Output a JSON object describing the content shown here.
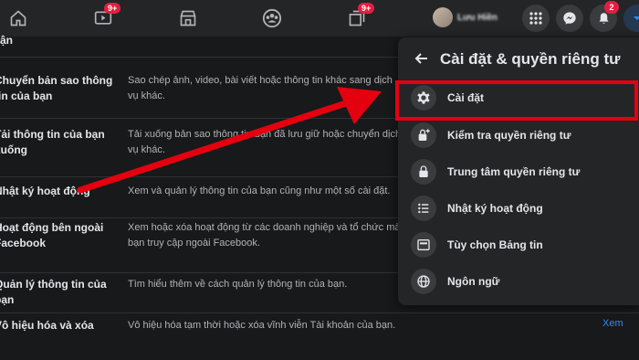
{
  "topbar": {
    "nav": [
      {
        "name": "home-icon"
      },
      {
        "name": "watch-icon",
        "badge": "9+"
      },
      {
        "name": "marketplace-icon"
      },
      {
        "name": "groups-icon"
      },
      {
        "name": "gaming-icon",
        "badge": "9+"
      }
    ],
    "profile_name": "Lưu Hiền",
    "notifications_badge": "2"
  },
  "settings_rows": [
    {
      "label": "ận",
      "desc": ""
    },
    {
      "label": "Chuyển bản sao thông tin của bạn",
      "desc": "Sao chép ảnh, video, bài viết hoặc thông tin khác sang dịch vụ khác."
    },
    {
      "label": "Tải thông tin của bạn xuống",
      "desc": "Tải xuống bản sao thông tin bạn đã lưu giữ hoặc chuyển dịch vụ khác."
    },
    {
      "label": "Nhật ký hoạt động",
      "desc": "Xem và quản lý thông tin của bạn cũng như một số cài đặt."
    },
    {
      "label": "Hoạt động bên ngoài Facebook",
      "desc": "Xem hoặc xóa hoạt động từ các doanh nghiệp và tổ chức mà bạn truy cập ngoài Facebook."
    },
    {
      "label": "Quản lý thông tin của bạn",
      "desc": "Tìm hiểu thêm về cách quản lý thông tin của bạn."
    },
    {
      "label": "Vô hiệu hóa và xóa",
      "desc": "Vô hiệu hóa tạm thời hoặc xóa vĩnh viễn Tài khoản của bạn.",
      "action": "Xem"
    }
  ],
  "panel": {
    "title": "Cài đặt & quyền riêng tư",
    "items": [
      {
        "label": "Cài đặt",
        "icon": "gear-icon"
      },
      {
        "label": "Kiểm tra quyền riêng tư",
        "icon": "lock-plus-icon"
      },
      {
        "label": "Trung tâm quyền riêng tư",
        "icon": "lock-icon"
      },
      {
        "label": "Nhật ký hoạt động",
        "icon": "list-icon"
      },
      {
        "label": "Tùy chọn Bảng tin",
        "icon": "feed-icon"
      },
      {
        "label": "Ngôn ngữ",
        "icon": "globe-icon"
      }
    ]
  },
  "colors": {
    "highlight": "#e4000f",
    "accent": "#2d88ff"
  }
}
